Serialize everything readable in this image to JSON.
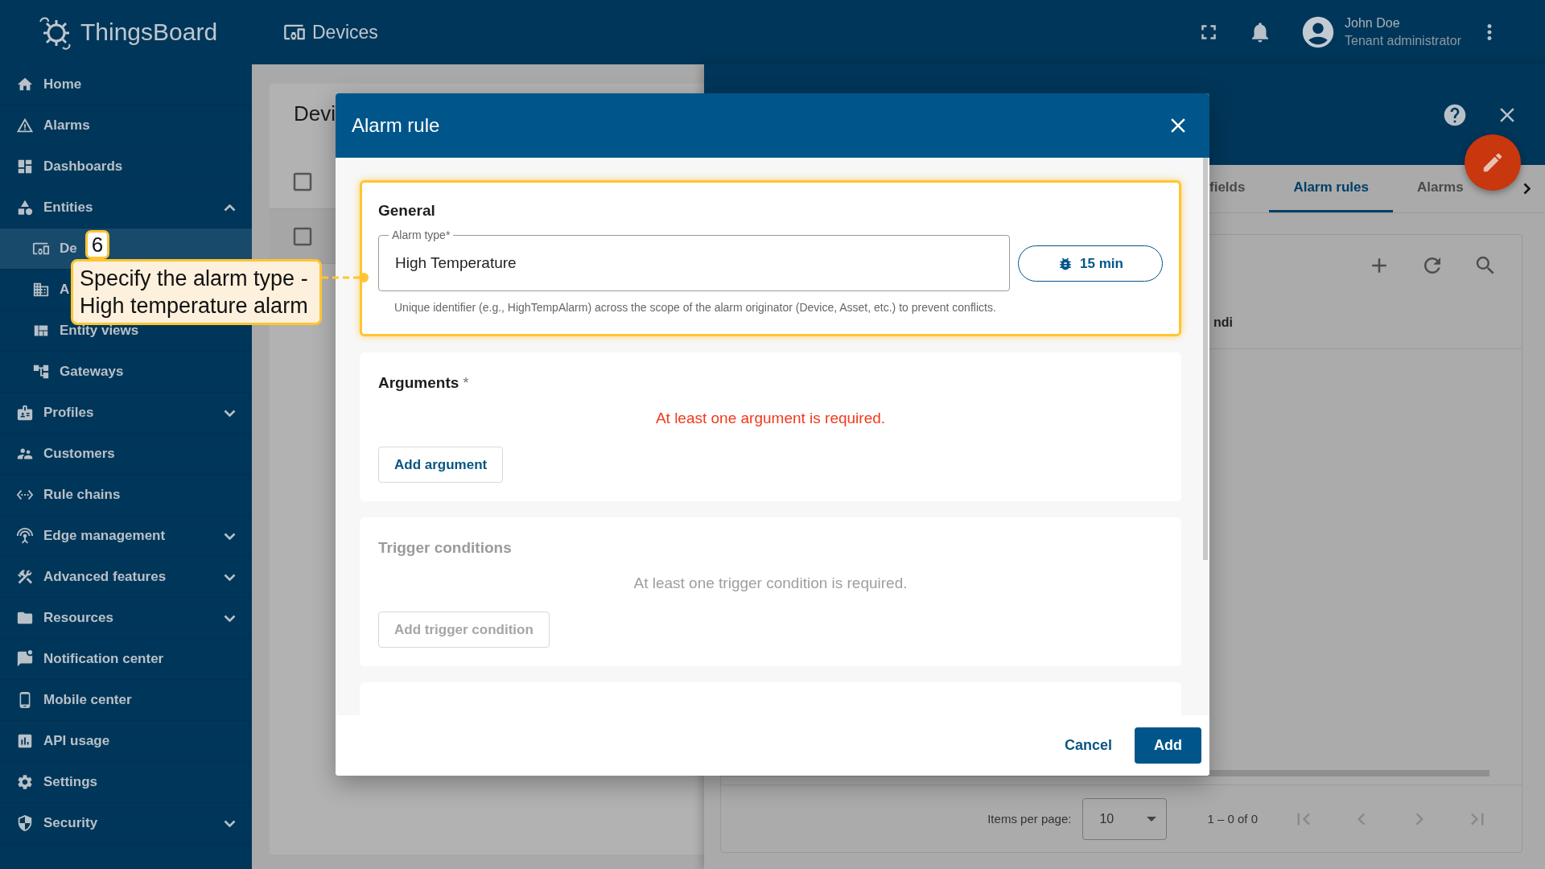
{
  "app": {
    "logo_text": "ThingsBoard",
    "page_title": "Devices"
  },
  "user": {
    "name": "John Doe",
    "role": "Tenant administrator"
  },
  "sidebar": {
    "items": [
      {
        "label": "Home"
      },
      {
        "label": "Alarms"
      },
      {
        "label": "Dashboards"
      },
      {
        "label": "Entities",
        "expanded": true,
        "children": [
          {
            "label": "De",
            "selected": true
          },
          {
            "label": "A",
            "selected": false
          },
          {
            "label": "Entity views",
            "selected": false
          },
          {
            "label": "Gateways",
            "selected": false
          }
        ]
      },
      {
        "label": "Profiles",
        "expanded": false
      },
      {
        "label": "Customers"
      },
      {
        "label": "Rule chains"
      },
      {
        "label": "Edge management",
        "expanded": false
      },
      {
        "label": "Advanced features",
        "expanded": false
      },
      {
        "label": "Resources",
        "expanded": false
      },
      {
        "label": "Notification center"
      },
      {
        "label": "Mobile center"
      },
      {
        "label": "API usage"
      },
      {
        "label": "Settings"
      },
      {
        "label": "Security",
        "expanded": false
      }
    ]
  },
  "list_panel": {
    "title": "Devi",
    "rows": [
      {
        "checked": false
      },
      {
        "checked": false
      }
    ]
  },
  "details_panel": {
    "tabs": [
      {
        "label": "fields",
        "selected": false
      },
      {
        "label": "Alarm rules",
        "selected": true
      },
      {
        "label": "Alarms",
        "selected": false
      }
    ],
    "column_1": "ndi",
    "pagination": {
      "label": "Items per page:",
      "page_size": "10",
      "range": "1 – 0 of 0"
    }
  },
  "dialog": {
    "title": "Alarm rule",
    "general": {
      "title": "General",
      "highlighted": true,
      "field_label": "Alarm type*",
      "field_value": "High Temperature",
      "interval_button": "15 min",
      "hint": "Unique identifier (e.g., HighTempAlarm) across the scope of the alarm originator (Device, Asset, etc.) to prevent conflicts."
    },
    "sections": [
      {
        "title": "Arguments",
        "required_mark": "*",
        "disabled": false,
        "message": "At least one argument is required.",
        "button": "Add argument"
      },
      {
        "title": "Trigger conditions",
        "disabled": true,
        "message": "At least one trigger condition is required.",
        "button": "Add trigger condition"
      }
    ],
    "buttons": {
      "cancel": "Cancel",
      "confirm": "Add"
    }
  },
  "callout": {
    "number": "6",
    "text": "Specify the alarm type - High temperature alarm"
  }
}
